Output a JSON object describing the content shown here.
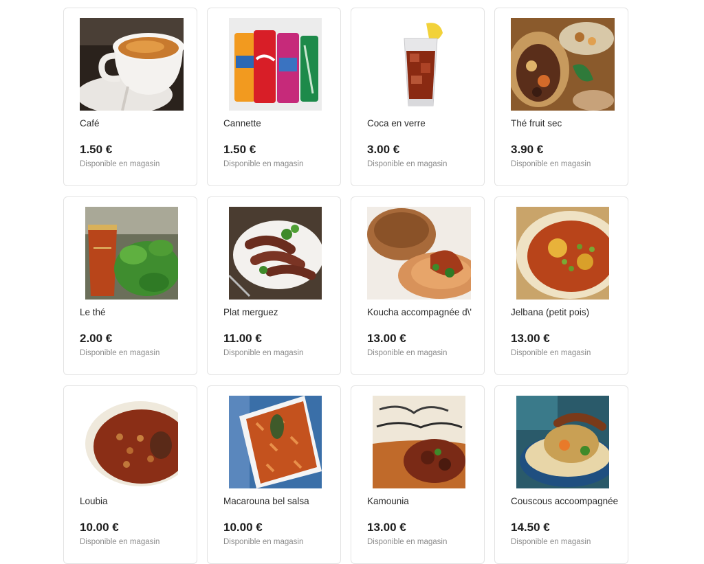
{
  "products": [
    {
      "name": "Café",
      "price": "1.50 €",
      "availability": "Disponible en magasin",
      "image_icon": "coffee-cup-photo"
    },
    {
      "name": "Cannette",
      "price": "1.50 €",
      "availability": "Disponible en magasin",
      "image_icon": "soda-cans-photo"
    },
    {
      "name": "Coca en verre",
      "price": "3.00 €",
      "availability": "Disponible en magasin",
      "image_icon": "cola-glass-photo"
    },
    {
      "name": "Thé fruit sec",
      "price": "3.90 €",
      "availability": "Disponible en magasin",
      "image_icon": "dried-fruits-photo"
    },
    {
      "name": "Le thé",
      "price": "2.00 €",
      "availability": "Disponible en magasin",
      "image_icon": "mint-tea-photo"
    },
    {
      "name": "Plat merguez",
      "price": "11.00 €",
      "availability": "Disponible en magasin",
      "image_icon": "merguez-plate-photo"
    },
    {
      "name": "Koucha accompagnée d\\'",
      "price": "13.00 €",
      "availability": "Disponible en magasin",
      "image_icon": "koucha-dish-photo"
    },
    {
      "name": "Jelbana (petit pois)",
      "price": "13.00 €",
      "availability": "Disponible en magasin",
      "image_icon": "jelbana-stew-photo"
    },
    {
      "name": "Loubia",
      "price": "10.00 €",
      "availability": "Disponible en magasin",
      "image_icon": "bean-stew-photo"
    },
    {
      "name": "Macarouna bel salsa",
      "price": "10.00 €",
      "availability": "Disponible en magasin",
      "image_icon": "pasta-sauce-photo"
    },
    {
      "name": "Kamounia",
      "price": "13.00 €",
      "availability": "Disponible en magasin",
      "image_icon": "kamounia-tajine-photo"
    },
    {
      "name": "Couscous accoompagnée",
      "price": "14.50 €",
      "availability": "Disponible en magasin",
      "image_icon": "couscous-bowl-photo"
    }
  ]
}
